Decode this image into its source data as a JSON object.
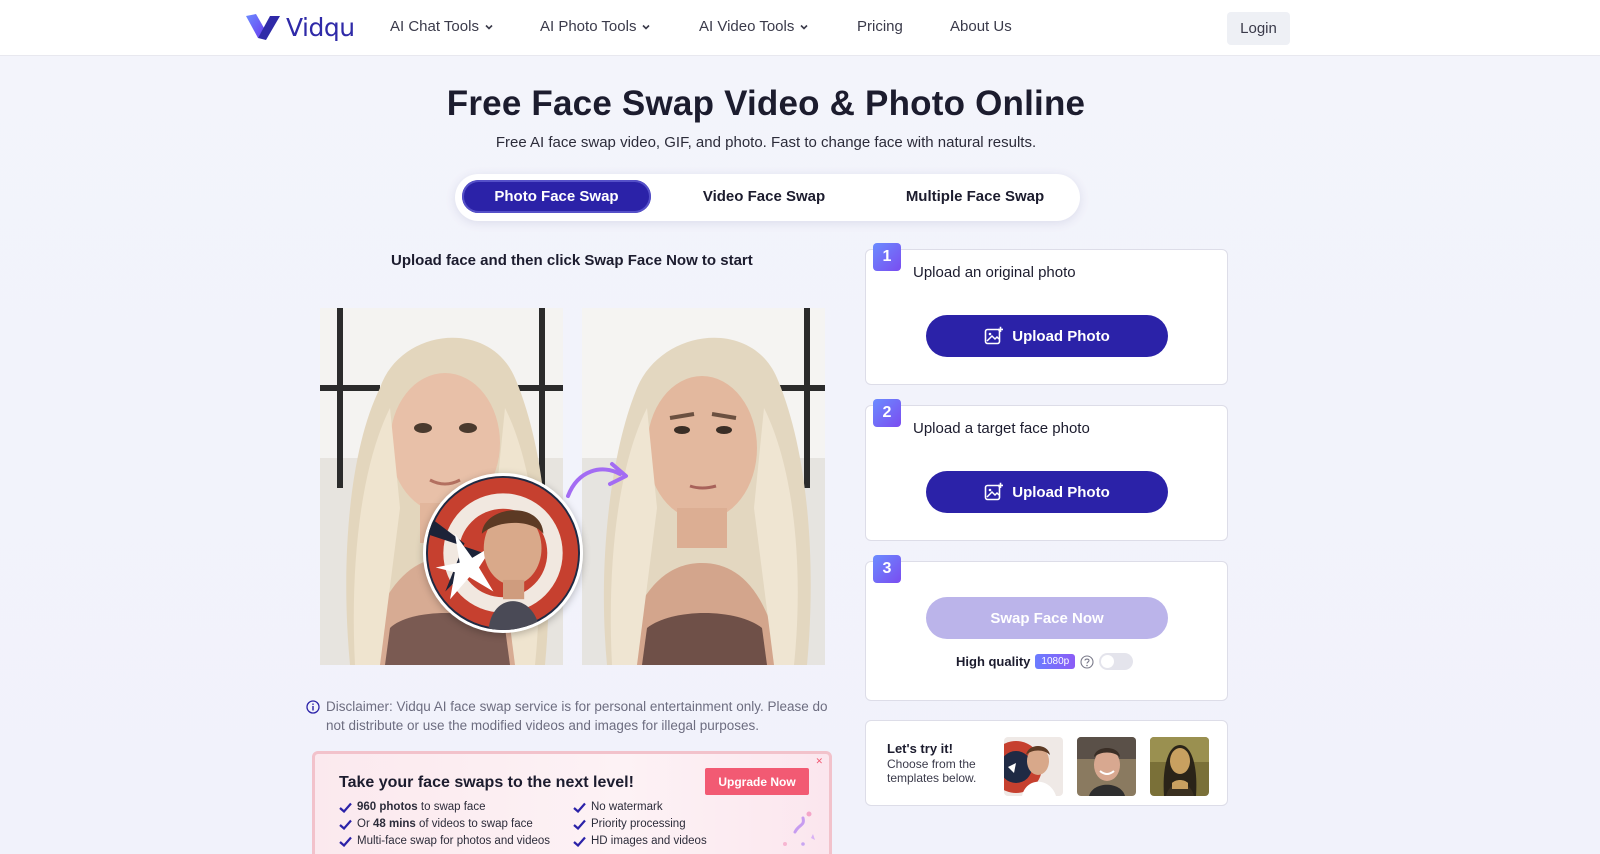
{
  "brand": {
    "name": "Vidqu",
    "color": "#2b22a8"
  },
  "nav": {
    "items": [
      {
        "label": "AI Chat Tools",
        "dropdown": true
      },
      {
        "label": "AI Photo Tools",
        "dropdown": true
      },
      {
        "label": "AI Video Tools",
        "dropdown": true
      },
      {
        "label": "Pricing",
        "dropdown": false
      },
      {
        "label": "About Us",
        "dropdown": false
      }
    ],
    "login": "Login"
  },
  "hero": {
    "title": "Free Face Swap Video & Photo Online",
    "subtitle": "Free AI face swap video, GIF, and photo. Fast to change face with natural results."
  },
  "tabs": [
    {
      "label": "Photo Face Swap",
      "active": true
    },
    {
      "label": "Video Face Swap",
      "active": false
    },
    {
      "label": "Multiple Face Swap",
      "active": false
    }
  ],
  "left": {
    "hint": "Upload face and then click Swap Face Now to start",
    "disclaimer": "Disclaimer: Vidqu AI face swap service is for personal entertainment only. Please do not distribute or use the modified videos and images for illegal purposes."
  },
  "promo": {
    "title": "Take your face swaps to the next level!",
    "button": "Upgrade Now",
    "features_left": [
      {
        "bold": "960 photos",
        "rest": " to swap face",
        "prefix": ""
      },
      {
        "bold": "48 mins",
        "rest": " of videos to swap face",
        "prefix": "Or "
      },
      {
        "bold": "",
        "rest": "Multi-face swap for photos and videos",
        "prefix": ""
      }
    ],
    "features_right": [
      "No watermark",
      "Priority processing",
      "HD images and videos"
    ]
  },
  "steps": [
    {
      "number": "1",
      "label": "Upload an original photo",
      "button": "Upload Photo"
    },
    {
      "number": "2",
      "label": "Upload a target face photo",
      "button": "Upload Photo"
    },
    {
      "number": "3",
      "label": "",
      "button": "Swap Face Now"
    }
  ],
  "quality": {
    "label": "High quality",
    "badge": "1080p",
    "enabled": false
  },
  "try": {
    "title": "Let's try it!",
    "description": "Choose from the templates below."
  }
}
